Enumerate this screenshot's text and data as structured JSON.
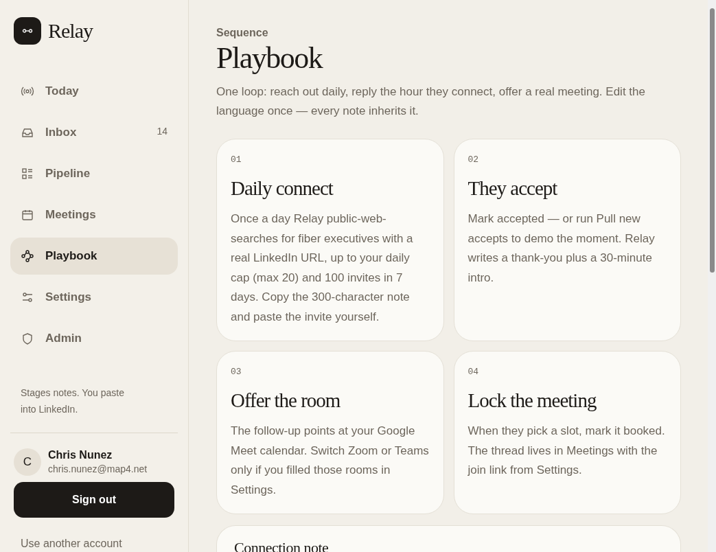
{
  "brand": {
    "name": "Relay"
  },
  "nav": [
    {
      "label": "Today",
      "kind": "broadcast",
      "selected": false
    },
    {
      "label": "Inbox",
      "kind": "inbox",
      "badge": "14",
      "selected": false
    },
    {
      "label": "Pipeline",
      "kind": "list",
      "selected": false
    },
    {
      "label": "Meetings",
      "kind": "calendar",
      "selected": false
    },
    {
      "label": "Playbook",
      "kind": "flow",
      "selected": true
    },
    {
      "label": "Settings",
      "kind": "sliders",
      "selected": false
    },
    {
      "label": "Admin",
      "kind": "shield",
      "selected": false
    }
  ],
  "sidebar_note": "Stages notes. You paste into LinkedIn.",
  "user": {
    "initial": "C",
    "name": "Chris Nunez",
    "email": "chris.nunez@map4.net"
  },
  "sign_out": "Sign out",
  "other_account": "Use another account",
  "header": {
    "eyebrow": "Sequence",
    "title": "Playbook",
    "description": "One loop: reach out daily, reply the hour they connect, offer a real meeting. Edit the language once — every note inherits it."
  },
  "steps": [
    {
      "number": "01",
      "title": "Daily connect",
      "body": "Once a day Relay public-web-searches for fiber executives with a real LinkedIn URL, up to your daily cap (max 20) and 100 invites in 7 days. Copy the 300-character note and paste the invite yourself."
    },
    {
      "number": "02",
      "title": "They accept",
      "body": "Mark accepted — or run Pull new accepts to demo the moment. Relay writes a thank-you plus a 30-minute intro."
    },
    {
      "number": "03",
      "title": "Offer the room",
      "body": "The follow-up points at your Google Meet calendar. Switch Zoom or Teams only if you filled those rooms in Settings."
    },
    {
      "number": "04",
      "title": "Lock the meeting",
      "body": "When they pick a slot, mark it booked. The thread lives in Meetings with the join link from Settings."
    }
  ],
  "next_card": {
    "title": "Connection note"
  }
}
